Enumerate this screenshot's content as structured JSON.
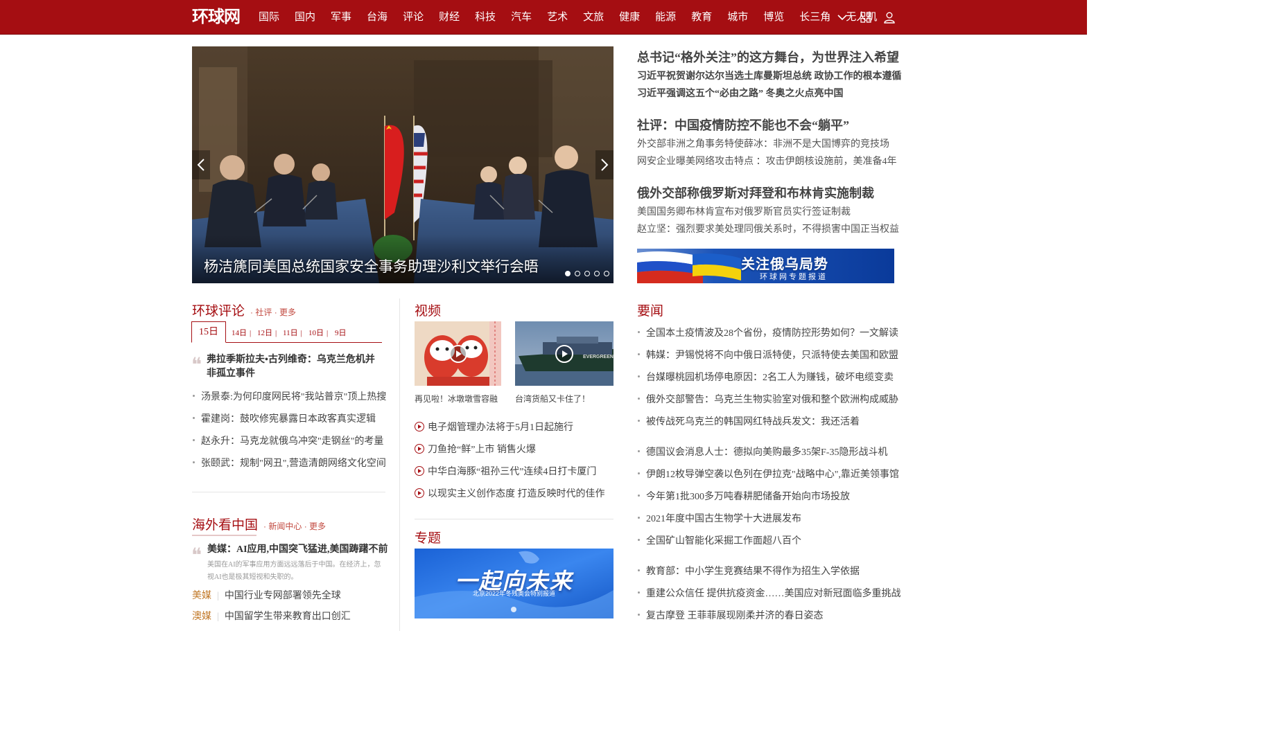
{
  "nav": {
    "logo": "环球网",
    "items": [
      "国际",
      "国内",
      "军事",
      "台海",
      "评论",
      "财经",
      "科技",
      "汽车",
      "艺术",
      "文旅",
      "健康",
      "能源",
      "教育",
      "城市",
      "博览",
      "长三角",
      "无人机"
    ]
  },
  "carousel": {
    "caption": "杨洁篪同美国总统国家安全事务助理沙利文举行会晤",
    "slide_count": 5,
    "active_index": 0
  },
  "headlines": [
    {
      "main": "总书记“格外关注”的这方舞台，为世界注入希望",
      "subs": [
        "习近平祝贺谢尔达尔当选土库曼斯坦总统 政协工作的根本遵循",
        "习近平强调这五个“必由之路” 冬奥之火点亮中国"
      ],
      "subs_bold": true
    },
    {
      "main": "社评：中国疫情防控不能也不会“躺平”",
      "subs": [
        "外交部非洲之角事务特使薛冰：非洲不是大国博弈的竞技场",
        "网安企业曝美网络攻击特点 ：攻击伊朗核设施前，美准备4年"
      ],
      "subs_bold": false
    },
    {
      "main": "俄外交部称俄罗斯对拜登和布林肯实施制裁",
      "subs": [
        "美国国务卿布林肯宣布对俄罗斯官员实行签证制裁",
        "赵立坚：强烈要求美处理同俄关系时，不得损害中国正当权益"
      ],
      "subs_bold": false
    }
  ],
  "banner_ru": {
    "title": "关注俄乌局势",
    "subtitle": "环球网专题报道"
  },
  "commentary": {
    "title": "环球评论",
    "links": [
      "社评",
      "更多"
    ],
    "active_date": "15日",
    "dates": [
      "14日",
      "12日",
      "11日",
      "10日",
      "9日"
    ],
    "feature": "弗拉季斯拉夫•古列维奇：乌克兰危机并非孤立事件",
    "items": [
      "汤景泰:为何印度网民将\"我站普京\"顶上热搜",
      "霍建岗：鼓吹修宪暴露日本政客真实逻辑",
      "赵永升：马克龙就俄乌冲突\"走钢丝\"的考量",
      "张颐武：规制\"网丑\",营造清朗网络文化空间"
    ]
  },
  "overseas": {
    "title": "海外看中国",
    "links": [
      "新闻中心",
      "更多"
    ],
    "feature": "美媒：AI应用,中国突飞猛进,美国踌躇不前",
    "feature_desc": "美国在AI的军事应用方面远远落后于中国。在经济上，忽视AI也是极其短视和失职的。",
    "rows": [
      {
        "tag": "美媒",
        "text": "中国行业专网部署领先全球"
      },
      {
        "tag": "澳媒",
        "text": "中国留学生带来教育出口创汇"
      }
    ]
  },
  "video": {
    "title": "视频",
    "thumbs": [
      {
        "caption": "再见啦！冰墩墩雪容融"
      },
      {
        "caption": "台湾货船又卡住了！"
      }
    ],
    "links": [
      "电子烟管理办法将于5月1日起施行",
      "刀鱼抢“鲜”上市 销售火爆",
      "中华白海豚“祖孙三代”连续4日打卡厦门",
      "以现实主义创作态度 打造反映时代的佳作"
    ]
  },
  "topic": {
    "title": "专题",
    "banner_title": "一起向未来",
    "banner_sub": "北京2022年冬残奥会特别报道"
  },
  "news": {
    "title": "要闻",
    "groups": [
      [
        "全国本土疫情波及28个省份，疫情防控形势如何？一文解读",
        "韩媒：尹锡悦将不向中俄日派特使，只派特使去美国和欧盟",
        "台媒曝桃园机场停电原因：2名工人为赚钱，破坏电缆变卖",
        "俄外交部警告：乌克兰生物实验室对俄和整个欧洲构成威胁",
        "被传战死乌克兰的韩国网红特战兵发文：我还活着"
      ],
      [
        "德国议会消息人士：德拟向美购最多35架F-35隐形战斗机",
        "伊朗12枚导弹空袭以色列在伊拉克\"战略中心\",靠近美领事馆",
        "今年第1批300多万吨春耕肥储备开始向市场投放",
        "2021年度中国古生物学十大进展发布",
        "全国矿山智能化采掘工作面超八百个"
      ],
      [
        "教育部：中小学生竞赛结果不得作为招生入学依据",
        "重建公众信任 提供抗疫资金……美国应对新冠面临多重挑战",
        "复古摩登 王菲菲展现刚柔并济的春日姿态"
      ]
    ]
  },
  "colors": {
    "brand": "#a50e12",
    "accent_orange": "#c27a2a"
  }
}
